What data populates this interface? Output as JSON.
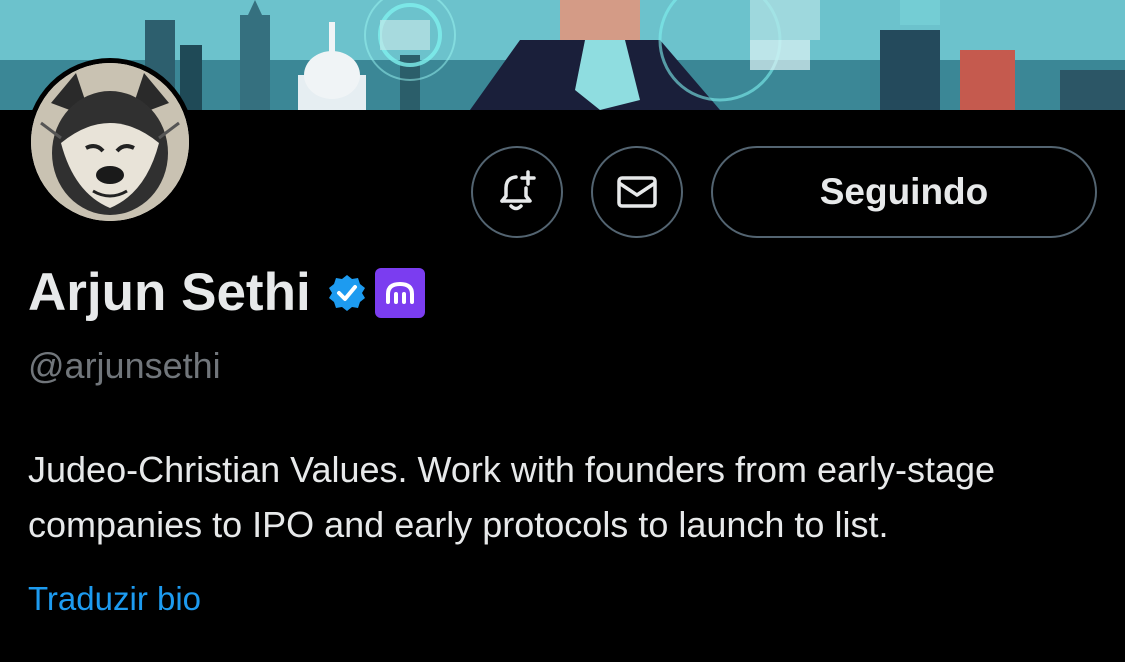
{
  "profile": {
    "name": "Arjun Sethi",
    "handle": "@arjunsethi",
    "bio": "Judeo-Christian Values. Work with founders from early-stage companies to IPO and early protocols to launch to list.",
    "translate_bio_label": "Traduzir bio",
    "verified": true,
    "affiliation_badge": "kraken-icon"
  },
  "actions": {
    "notifications_icon": "bell-plus-icon",
    "message_icon": "envelope-icon",
    "follow_label": "Seguindo"
  },
  "colors": {
    "background": "#000000",
    "primary_text": "#e7e9ea",
    "secondary_text": "#71767b",
    "link": "#1d9bf0",
    "verified_badge": "#1d9bf0",
    "affiliation_badge_bg": "#7b3df0",
    "button_border": "#536471"
  }
}
